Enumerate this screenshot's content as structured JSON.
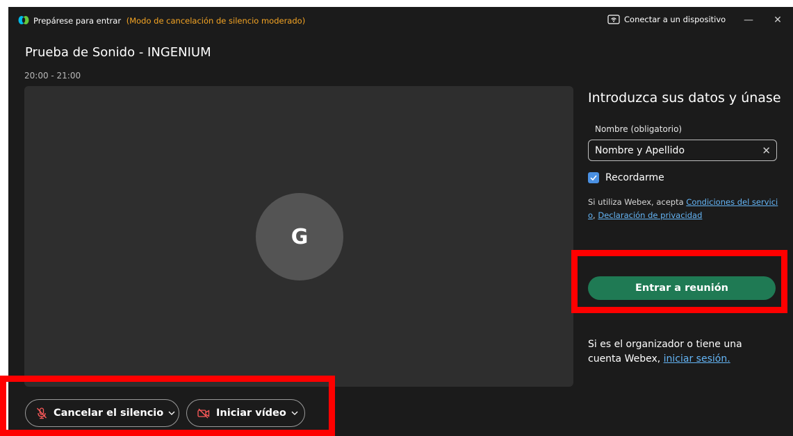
{
  "titlebar": {
    "title": "Prepárese para entrar",
    "mode": "(Modo de cancelación de silencio moderado)",
    "connect_label": "Conectar a un dispositivo",
    "minimize_symbol": "—",
    "close_symbol": "✕"
  },
  "meeting": {
    "title": "Prueba de Sonido - INGENIUM",
    "time": "20:00 - 21:00"
  },
  "preview": {
    "avatar_initial": "G"
  },
  "controls": {
    "mute_label": "Cancelar el silencio",
    "video_label": "Iniciar vídeo"
  },
  "join_panel": {
    "heading": "Introduzca sus datos y únase",
    "name_label": "Nombre (obligatorio)",
    "name_value": "Nombre y Apellido",
    "clear_symbol": "✕",
    "remember_label": "Recordarme",
    "remember_checked": true,
    "terms_prefix": "Si utiliza Webex, acepta ",
    "terms_link": "Condiciones del servicio",
    "terms_sep": ", ",
    "privacy_link": "Declaración de privacidad",
    "join_button": "Entrar a reunión",
    "organizer_text": "Si es el organizador o tiene una cuenta Webex, ",
    "signin_link": "iniciar sesión."
  },
  "colors": {
    "background": "#1b1b1b",
    "preview": "#2e2e2e",
    "accent_mode": "#f5a524",
    "join_button": "#1f7a54",
    "link": "#64b5f6",
    "checkbox": "#4a90e2",
    "annotation": "#ff0000"
  },
  "icons": {
    "app": "webex-logo-icon",
    "connect": "wireless-device-icon",
    "mute": "microphone-muted-icon",
    "video": "video-off-icon",
    "chevron": "chevron-down-icon",
    "check": "check-icon"
  }
}
